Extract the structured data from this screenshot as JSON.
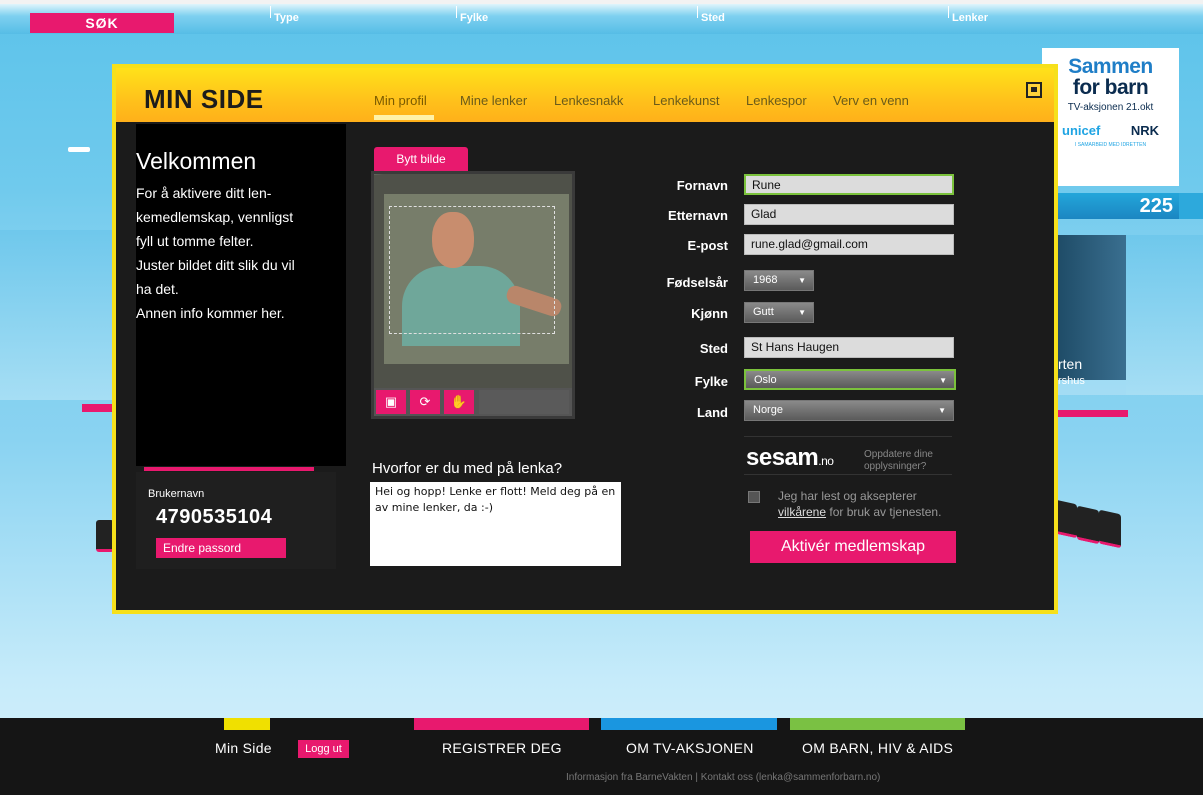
{
  "colors": {
    "accent_pink": "#e8196e",
    "modal_yellow": "#f6e01b",
    "bg_blue": "#5cc3ea",
    "footer_yellow": "#f0e000",
    "footer_blue": "#1a96e0",
    "footer_green": "#7ac143"
  },
  "topbar": {
    "search_label": "SØK",
    "filters": [
      "Type",
      "Fylke",
      "Sted",
      "Lenker"
    ]
  },
  "sponsor": {
    "line1": "Sammen",
    "line2": "for barn",
    "tagline": "TV-aksjonen 21.okt",
    "unicef": "unicef",
    "nrk": "NRK",
    "small": "I SAMARBEID MED IDRETTEN",
    "counter": "225"
  },
  "background": {
    "right_name": "rten",
    "right_place": "rshus"
  },
  "modal": {
    "title": "MIN SIDE",
    "tabs": [
      "Min profil",
      "Mine lenker",
      "Lenkesnakk",
      "Lenkekunst",
      "Lenkespor",
      "Verv en venn"
    ],
    "active_tab": "Min profil"
  },
  "welcome": {
    "title": "Velkommen",
    "lines": [
      "For å aktivere ditt len-",
      "kemedlemskap, vennligst",
      "fyll ut tomme felter.",
      "Juster bildet ditt slik du vil",
      "ha det.",
      "Annen info kommer her."
    ]
  },
  "user": {
    "label": "Brukernavn",
    "value": "4790535104",
    "change_password": "Endre passord"
  },
  "photo": {
    "change_label": "Bytt bilde",
    "tools": [
      "crop-icon",
      "rotate-icon",
      "hand-icon"
    ]
  },
  "why": {
    "label": "Hvorfor er du med på lenka?",
    "text": "Hei og hopp! Lenke er flott! Meld deg på en av mine lenker, da :-)"
  },
  "form": {
    "first_name_label": "Fornavn",
    "first_name": "Rune",
    "last_name_label": "Etternavn",
    "last_name": "Glad",
    "email_label": "E-post",
    "email": "rune.glad@gmail.com",
    "birth_year_label": "Fødselsår",
    "birth_year": "1968",
    "gender_label": "Kjønn",
    "gender": "Gutt",
    "place_label": "Sted",
    "place": "St Hans Haugen",
    "county_label": "Fylke",
    "county": "Oslo",
    "country_label": "Land",
    "country": "Norge"
  },
  "sesam": {
    "logo": "sesam",
    "logo_suffix": ".no",
    "update_text": "Oppdatere dine opplysninger?"
  },
  "terms": {
    "text_before": "Jeg har lest og aksepterer",
    "link": "vilkårene",
    "text_after": " for bruk av tjenesten."
  },
  "activate_label": "Aktivér medlemskap",
  "footer": {
    "min_side": "Min Side",
    "logout": "Logg ut",
    "register": "REGISTRER DEG",
    "about_tv": "OM TV-AKSJONEN",
    "about_children": "OM BARN, HIV & AIDS",
    "info": "Informasjon fra BarneVakten | Kontakt oss (lenka@sammenforbarn.no)"
  }
}
